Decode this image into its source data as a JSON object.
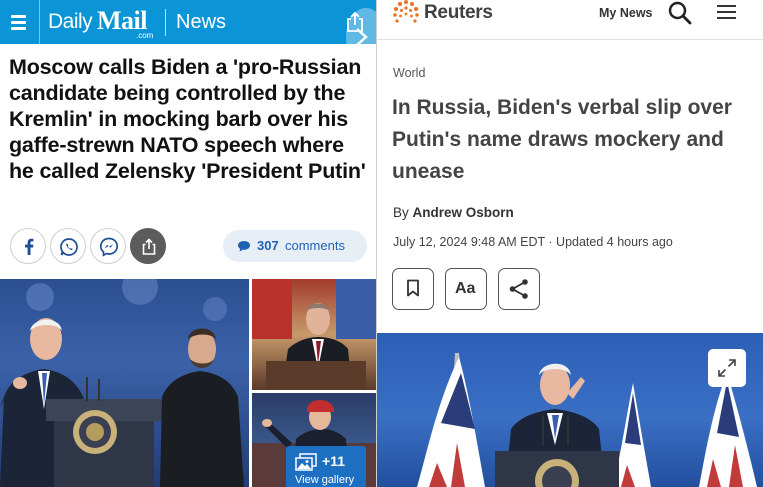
{
  "daily_mail": {
    "logo": {
      "daily": "Daily",
      "mail": "Mail",
      "com": ".com"
    },
    "section": "News",
    "headline": "Moscow calls Biden a 'pro-Russian candidate being controlled by the Kremlin' in mocking barb over his gaffe-strewn NATO speech where he called Zelensky 'President Putin'",
    "comments": {
      "count": "307",
      "label": "comments"
    },
    "gallery": {
      "count": "+11",
      "label": "View gallery"
    },
    "colors": {
      "header": "#0b94d6",
      "comment_text": "#1f63b5",
      "gallery_button": "#1d6fc2"
    }
  },
  "reuters": {
    "logo": "Reuters",
    "nav": {
      "my_news": "My News"
    },
    "section": "World",
    "headline": "In Russia, Biden's verbal slip over Putin's name draws mockery and unease",
    "byline": {
      "prefix": "By",
      "author": "Andrew Osborn"
    },
    "dateline": "July 12, 2024 9:48 AM EDT · Updated 4 hours ago",
    "tools": {
      "text_size": "Aa"
    },
    "colors": {
      "logo_orange": "#f26f21"
    }
  }
}
